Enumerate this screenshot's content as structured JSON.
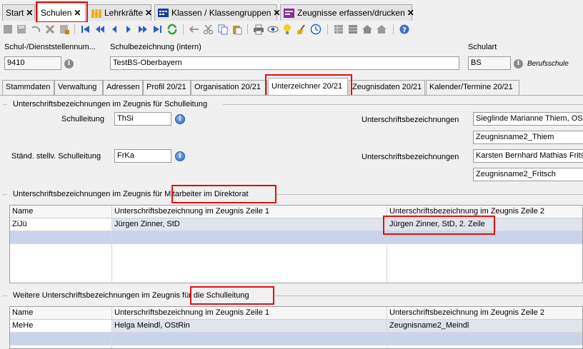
{
  "tabs": [
    {
      "label": "Start",
      "closable": true
    },
    {
      "label": "Schulen",
      "closable": true
    },
    {
      "label": "Lehrkräfte",
      "closable": true
    },
    {
      "label": "Klassen / Klassengruppen",
      "closable": true
    },
    {
      "label": "Zeugnisse erfassen/drucken",
      "closable": true
    }
  ],
  "fields": {
    "schulnummer_label": "Schul-/Dienststellennum...",
    "schulnummer_value": "9410",
    "schulbezeichnung_label": "Schulbezeichnung (intern)",
    "schulbezeichnung_value": "TestBS-Oberbayern",
    "schulart_label": "Schulart",
    "schulart_value": "BS",
    "schulart_text": "Berufsschule"
  },
  "subtabs": [
    "Stammdaten",
    "Verwaltung",
    "Adressen",
    "Profil 20/21",
    "Organisation 20/21",
    "Unterzeichner 20/21",
    "Zeugnisdaten 20/21",
    "Kalender/Termine 20/21"
  ],
  "section1": {
    "title": "Unterschriftsbezeichnungen im Zeugnis für Schulleitung",
    "schulleitung_label": "Schulleitung",
    "schulleitung_value": "ThSi",
    "unterschrift_label1": "Unterschriftsbezeichnungen",
    "sl_name1": "Sieglinde Marianne Thiem, OStD",
    "sl_name2": "Zeugnisname2_Thiem",
    "stellv_label": "Ständ. stellv. Schulleitung",
    "stellv_value": "FrKa",
    "unterschrift_label2": "Unterschriftsbezeichnungen",
    "st_name1": "Karsten Bernhard Mathias Fritsch",
    "st_name2": "Zeugnisname2_Fritsch"
  },
  "section2": {
    "title": "Unterschriftsbezeichnungen im Zeugnis für Mitarbeiter im Direktorat",
    "columns": [
      "Name",
      "Unterschriftsbezeichnung im Zeugnis Zeile 1",
      "Unterschriftsbezeichnung im Zeugnis Zeile 2"
    ],
    "rows": [
      [
        "ZiJü",
        "Jürgen Zinner, StD",
        "Jürgen Zinner, StD, 2. Zeile"
      ]
    ]
  },
  "section3": {
    "title": "Weitere Unterschriftsbezeichnungen im Zeugnis für die Schulleitung",
    "columns": [
      "Name",
      "Unterschriftsbezeichnung im Zeugnis Zeile 1",
      "Unterschriftsbezeichnung im Zeugnis Zeile 2"
    ],
    "rows": [
      [
        "MeHe",
        "Helga Meindl, OStRin",
        "Zeugnisname2_Meindl"
      ]
    ]
  },
  "icons": {
    "info": "info-icon",
    "close": "close-icon"
  },
  "colors": {
    "highlight": "#e01010",
    "selected_row": "#dfe4ed",
    "new_row": "#c9d4ea"
  }
}
